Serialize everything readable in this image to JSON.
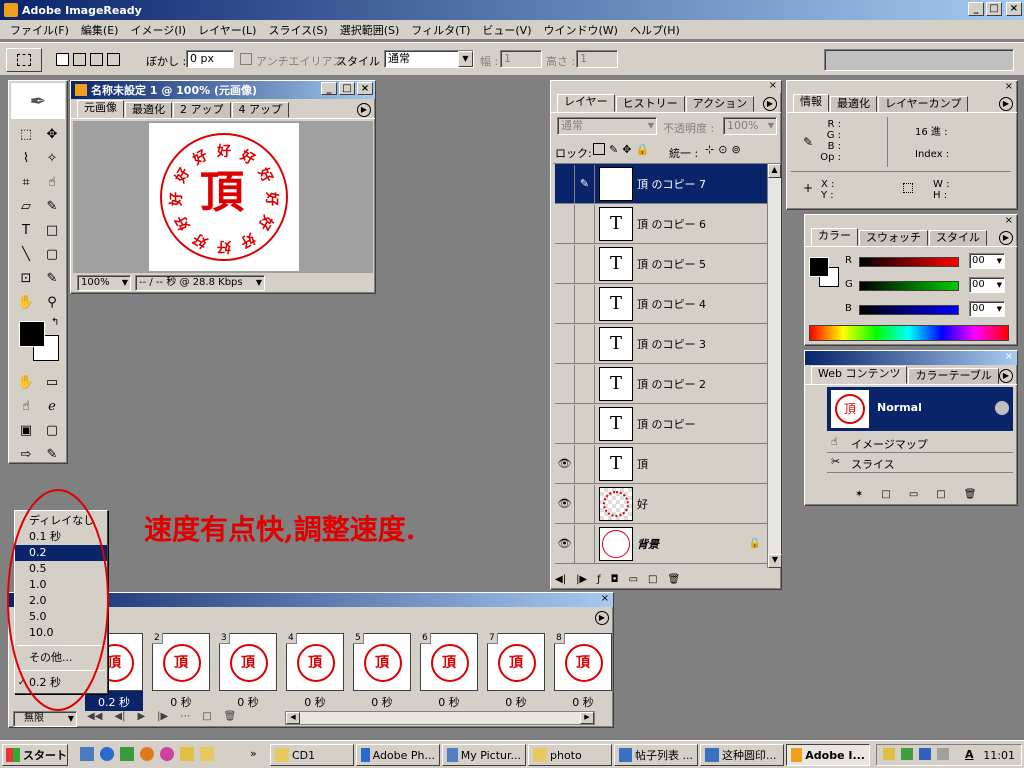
{
  "app": {
    "title": "Adobe ImageReady"
  },
  "menu": [
    "ファイル(F)",
    "編集(E)",
    "イメージ(I)",
    "レイヤー(L)",
    "スライス(S)",
    "選択範囲(S)",
    "フィルタ(T)",
    "ビュー(V)",
    "ウインドウ(W)",
    "ヘルプ(H)"
  ],
  "options": {
    "blur_label": "ぼかし :",
    "blur_value": "0 px",
    "antialias_label": "アンチエイリアス",
    "style_label": "スタイル :",
    "style_value": "通常",
    "width_label": "幅 :",
    "width_value": "1",
    "height_label": "高さ :",
    "height_value": "1"
  },
  "document": {
    "title": "名称未設定 1 @ 100% (元画像)",
    "tabs": [
      "元画像",
      "最適化",
      "2 アップ",
      "4 アップ"
    ],
    "zoom": "100%",
    "status": "-- / -- 秒 @ 28.8 Kbps",
    "stamp_center": "頂",
    "stamp_ring": [
      "好",
      "好",
      "好",
      "好",
      "好",
      "好",
      "好",
      "好",
      "好",
      "好",
      "好",
      "好"
    ]
  },
  "annotation": "速度有点快,調整速度.",
  "layers_panel": {
    "tabs": [
      "レイヤー",
      "ヒストリー",
      "アクション"
    ],
    "blend": "通常",
    "opacity_label": "不透明度 :",
    "opacity_value": "100%",
    "lock_label": "ロック:",
    "unify_label": "統一 :",
    "layers": [
      {
        "name": "頂 のコピー 7",
        "thumb": "T",
        "visible": false,
        "selected": true
      },
      {
        "name": "頂 のコピー 6",
        "thumb": "T",
        "visible": false,
        "selected": false
      },
      {
        "name": "頂 のコピー 5",
        "thumb": "T",
        "visible": false,
        "selected": false
      },
      {
        "name": "頂 のコピー 4",
        "thumb": "T",
        "visible": false,
        "selected": false
      },
      {
        "name": "頂 のコピー 3",
        "thumb": "T",
        "visible": false,
        "selected": false
      },
      {
        "name": "頂 のコピー 2",
        "thumb": "T",
        "visible": false,
        "selected": false
      },
      {
        "name": "頂 のコピー",
        "thumb": "T",
        "visible": false,
        "selected": false
      },
      {
        "name": "頂",
        "thumb": "T",
        "visible": true,
        "selected": false
      },
      {
        "name": "好",
        "thumb": "",
        "visible": true,
        "selected": false
      },
      {
        "name": "背景",
        "thumb": "",
        "visible": true,
        "selected": false
      }
    ]
  },
  "info_panel": {
    "tabs": [
      "情報",
      "最適化",
      "レイヤーカンプ"
    ],
    "r": "R :",
    "g": "G :",
    "b": "B :",
    "op": "Op :",
    "hex": "16 進 :",
    "index": "Index :",
    "x": "X :",
    "y": "Y :",
    "w": "W :",
    "h": "H :"
  },
  "color_panel": {
    "tabs": [
      "カラー",
      "スウォッチ",
      "スタイル"
    ],
    "r_label": "R",
    "g_label": "G",
    "b_label": "B",
    "r_value": "00",
    "g_value": "00",
    "b_value": "00"
  },
  "web_panel": {
    "tabs": [
      "Web コンテンツ",
      "カラーテーブル"
    ],
    "normal": "Normal",
    "imagemap": "イメージマップ",
    "slice": "スライス"
  },
  "animation": {
    "frames": [
      {
        "num": "1",
        "delay": "0.2 秒"
      },
      {
        "num": "2",
        "delay": "0 秒"
      },
      {
        "num": "3",
        "delay": "0 秒"
      },
      {
        "num": "4",
        "delay": "0 秒"
      },
      {
        "num": "5",
        "delay": "0 秒"
      },
      {
        "num": "6",
        "delay": "0 秒"
      },
      {
        "num": "7",
        "delay": "0 秒"
      },
      {
        "num": "8",
        "delay": "0 秒"
      }
    ],
    "loop": "無限",
    "delay_menu": [
      "ディレイなし",
      "0.1 秒",
      "0.2",
      "0.5",
      "1.0",
      "2.0",
      "5.0",
      "10.0",
      "その他...",
      "0.2 秒"
    ],
    "delay_menu_selected": 2
  },
  "taskbar": {
    "start": "スタート",
    "tasks": [
      "CD1",
      "Adobe Ph...",
      "My Pictur...",
      "photo",
      "帖子列表 ...",
      "这种圆印...",
      "Adobe I..."
    ],
    "time": "11:01",
    "ime": "A"
  },
  "colors": {
    "title_start": "#0a246a",
    "title_end": "#a6caf0",
    "stamp": "#dd0000",
    "annotation": "#e00000"
  }
}
